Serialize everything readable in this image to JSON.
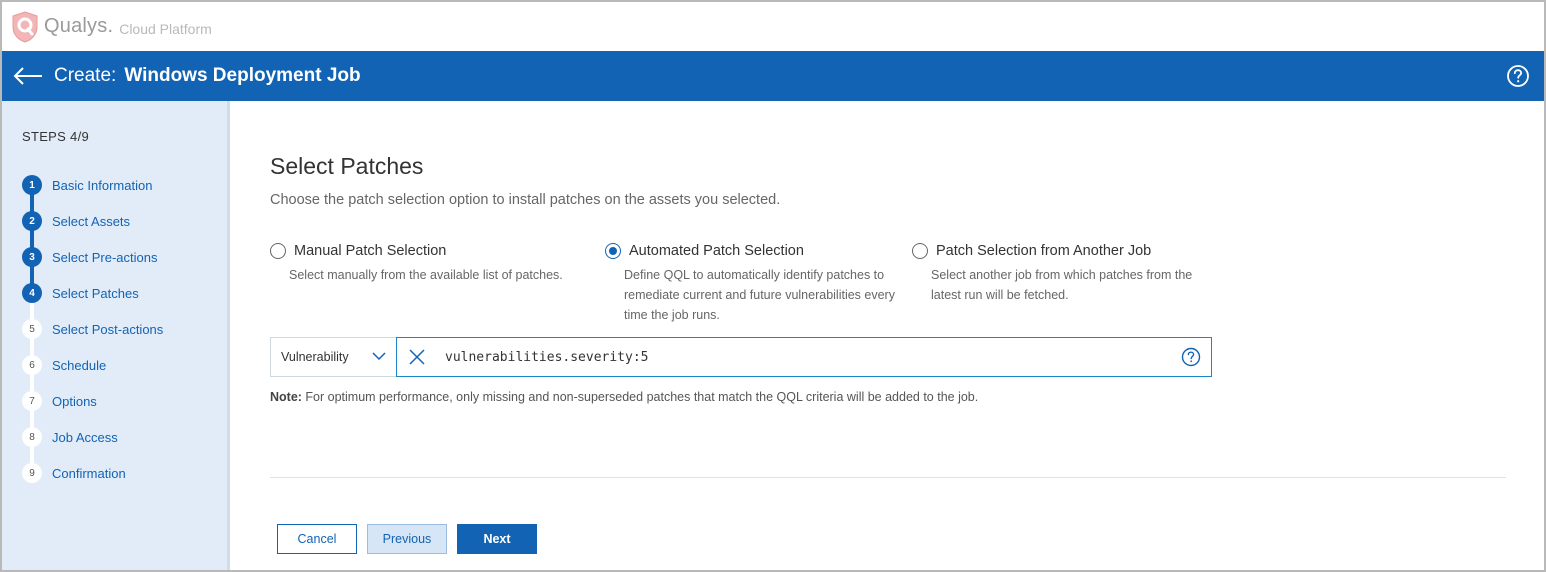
{
  "brand": {
    "name": "Qualys.",
    "sub": "Cloud Platform"
  },
  "header": {
    "prefix": "Create:",
    "title": "Windows Deployment Job"
  },
  "sidebar": {
    "steps_label": "STEPS 4/9",
    "steps": [
      {
        "number": "1",
        "label": "Basic Information",
        "done": true
      },
      {
        "number": "2",
        "label": "Select Assets",
        "done": true
      },
      {
        "number": "3",
        "label": "Select Pre-actions",
        "done": true
      },
      {
        "number": "4",
        "label": "Select Patches",
        "done": true
      },
      {
        "number": "5",
        "label": "Select Post-actions",
        "done": false
      },
      {
        "number": "6",
        "label": "Schedule",
        "done": false
      },
      {
        "number": "7",
        "label": "Options",
        "done": false
      },
      {
        "number": "8",
        "label": "Job Access",
        "done": false
      },
      {
        "number": "9",
        "label": "Confirmation",
        "done": false
      }
    ]
  },
  "main": {
    "title": "Select Patches",
    "subtitle": "Choose the patch selection option to install patches on the assets you selected.",
    "options": [
      {
        "title": "Manual Patch Selection",
        "desc": "Select manually from the available list of patches.",
        "checked": false
      },
      {
        "title": "Automated Patch Selection",
        "desc": "Define QQL to automatically identify patches to remediate current and future vulnerabilities every time the job runs.",
        "checked": true
      },
      {
        "title": "Patch Selection from Another Job",
        "desc": "Select another job from which patches from the latest run will be fetched.",
        "checked": false
      }
    ],
    "qql": {
      "select_value": "Vulnerability",
      "query": "vulnerabilities.severity:5"
    },
    "note_label": "Note:",
    "note_text": " For optimum performance, only missing and non-superseded patches that match the QQL criteria will be added to the job."
  },
  "buttons": {
    "cancel": "Cancel",
    "previous": "Previous",
    "next": "Next"
  },
  "colors": {
    "accent": "#1363b4",
    "sidebar_bg": "#e1ecf8",
    "brand_logo": "#e8a0a0"
  }
}
